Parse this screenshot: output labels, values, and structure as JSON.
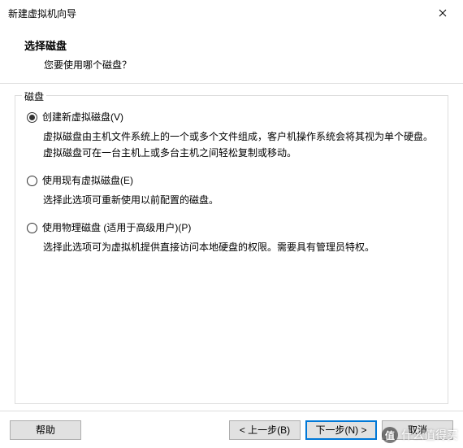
{
  "window": {
    "title": "新建虚拟机向导"
  },
  "header": {
    "heading": "选择磁盘",
    "subheading": "您要使用哪个磁盘？"
  },
  "group": {
    "legend": "磁盘",
    "options": [
      {
        "label": "创建新虚拟磁盘(V)",
        "desc": "虚拟磁盘由主机文件系统上的一个或多个文件组成，客户机操作系统会将其视为单个硬盘。虚拟磁盘可在一台主机上或多台主机之间轻松复制或移动。",
        "checked": true
      },
      {
        "label": "使用现有虚拟磁盘(E)",
        "desc": "选择此选项可重新使用以前配置的磁盘。",
        "checked": false
      },
      {
        "label": "使用物理磁盘 (适用于高级用户)(P)",
        "desc": "选择此选项可为虚拟机提供直接访问本地硬盘的权限。需要具有管理员特权。",
        "checked": false
      }
    ]
  },
  "footer": {
    "help": "帮助",
    "back": "< 上一步(B)",
    "next": "下一步(N) >",
    "cancel": "取消"
  },
  "watermark": {
    "icon_text": "值",
    "text": "什么值得买"
  }
}
